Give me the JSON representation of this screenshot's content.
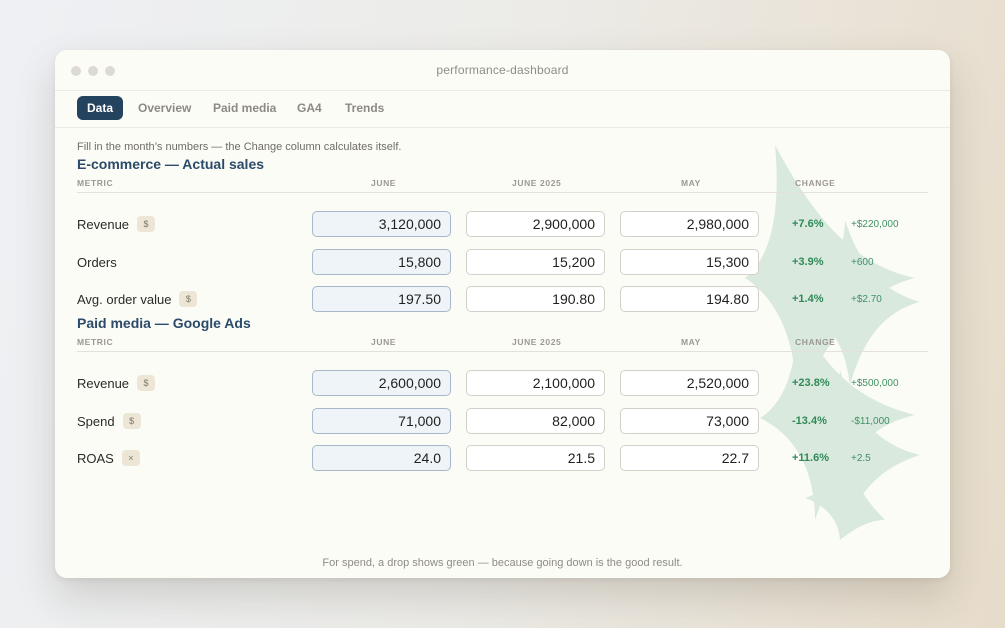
{
  "window": {
    "title": "performance-dashboard"
  },
  "tabs": [
    {
      "label": "Data",
      "active": true
    },
    {
      "label": "Overview",
      "active": false
    },
    {
      "label": "Paid media",
      "active": false
    },
    {
      "label": "GA4",
      "active": false
    },
    {
      "label": "Trends",
      "active": false
    }
  ],
  "intro": "Fill in the month’s numbers — the Change column calculates itself.",
  "columns": {
    "metric": "METRIC",
    "current": "JUNE",
    "prior_year": "JUNE 2025",
    "prior_month": "MAY",
    "change": "CHANGE"
  },
  "sections": [
    {
      "title": "E-commerce — Actual sales",
      "rows": [
        {
          "metric": "Revenue",
          "unit": "$",
          "june": "3,120,000",
          "june_2025": "2,900,000",
          "may": "2,980,000",
          "change_pct": "+7.6%",
          "change_abs": "+$220,000"
        },
        {
          "metric": "Orders",
          "unit": "",
          "june": "15,800",
          "june_2025": "15,200",
          "may": "15,300",
          "change_pct": "+3.9%",
          "change_abs": "+600"
        },
        {
          "metric": "Avg. order value",
          "unit": "$",
          "june": "197.50",
          "june_2025": "190.80",
          "may": "194.80",
          "change_pct": "+1.4%",
          "change_abs": "+$2.70"
        }
      ]
    },
    {
      "title": "Paid media — Google Ads",
      "rows": [
        {
          "metric": "Revenue",
          "unit": "$",
          "june": "2,600,000",
          "june_2025": "2,100,000",
          "may": "2,520,000",
          "change_pct": "+23.8%",
          "change_abs": "+$500,000"
        },
        {
          "metric": "Spend",
          "unit": "$",
          "june": "71,000",
          "june_2025": "82,000",
          "may": "73,000",
          "change_pct": "-13.4%",
          "change_abs": "-$11,000"
        },
        {
          "metric": "ROAS",
          "unit": "×",
          "june": "24.0",
          "june_2025": "21.5",
          "may": "22.7",
          "change_pct": "+11.6%",
          "change_abs": "+2.5"
        }
      ]
    }
  ],
  "footer": "For spend, a drop shows green — because going down is the good result.",
  "colors": {
    "accent": "#24435f",
    "section_title": "#2b4b69",
    "positive": "#2f8a57",
    "decor": "#cfe3d6"
  }
}
